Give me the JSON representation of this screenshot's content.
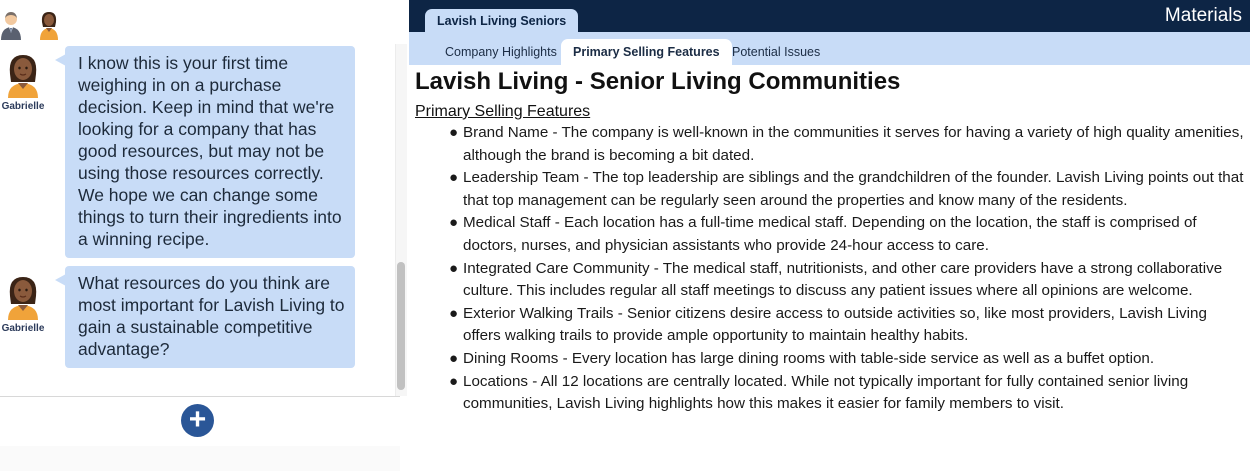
{
  "chat": {
    "participants": [
      {
        "name": "male-avatar",
        "icon": "businessman-avatar"
      },
      {
        "name": "female-avatar",
        "icon": "woman-avatar"
      }
    ],
    "messages": [
      {
        "sender": "Gabrielle",
        "text": "I know this is your first time weighing in on a purchase decision. Keep in mind that we're looking for a company that has good resources, but may not be using those resources correctly. We hope we can change some things to turn their ingredients into a winning recipe."
      },
      {
        "sender": "Gabrielle",
        "text": "What resources do you think are most important for Lavish Living to gain a sustainable competitive advantage?"
      }
    ],
    "add_button_label": "+"
  },
  "materials": {
    "title": "Materials",
    "company_tab": "Lavish Living Seniors",
    "subtabs": [
      "Company Highlights",
      "Primary Selling Features",
      "Potential Issues"
    ],
    "active_subtab": "Primary Selling Features",
    "heading": "Lavish Living - Senior Living Communities",
    "section_title": "Primary Selling Features",
    "features": [
      "Brand Name - The company is well-known in the communities it serves for having a variety of high quality amenities, although the brand is becoming a bit dated.",
      "Leadership Team - The top leadership are siblings and the grandchildren of the founder. Lavish Living points out that that top management can be regularly seen around the properties and know many of the residents.",
      "Medical Staff - Each location has a full-time medical staff. Depending on the location, the staff is comprised of doctors, nurses, and physician assistants who provide 24-hour access to care.",
      "Integrated Care Community - The medical staff, nutritionists, and other care providers have a strong collaborative culture. This includes regular all staff meetings to discuss any patient issues where all opinions are welcome.",
      "Exterior Walking Trails - Senior citizens desire access to outside activities so, like most providers, Lavish Living offers walking trails to provide ample opportunity to maintain healthy habits.",
      "Dining Rooms - Every location has large dining rooms with table-side service as well as a buffet option.",
      "Locations - All 12 locations are centrally located. While not typically important for fully contained senior living communities, Lavish Living highlights how this makes it easier for family members to visit."
    ],
    "bullet": "●"
  },
  "colors": {
    "header_navy": "#0d2545",
    "tab_blue": "#c8dcf7",
    "bubble_blue": "#c8dcf7",
    "add_button": "#2a5697"
  }
}
